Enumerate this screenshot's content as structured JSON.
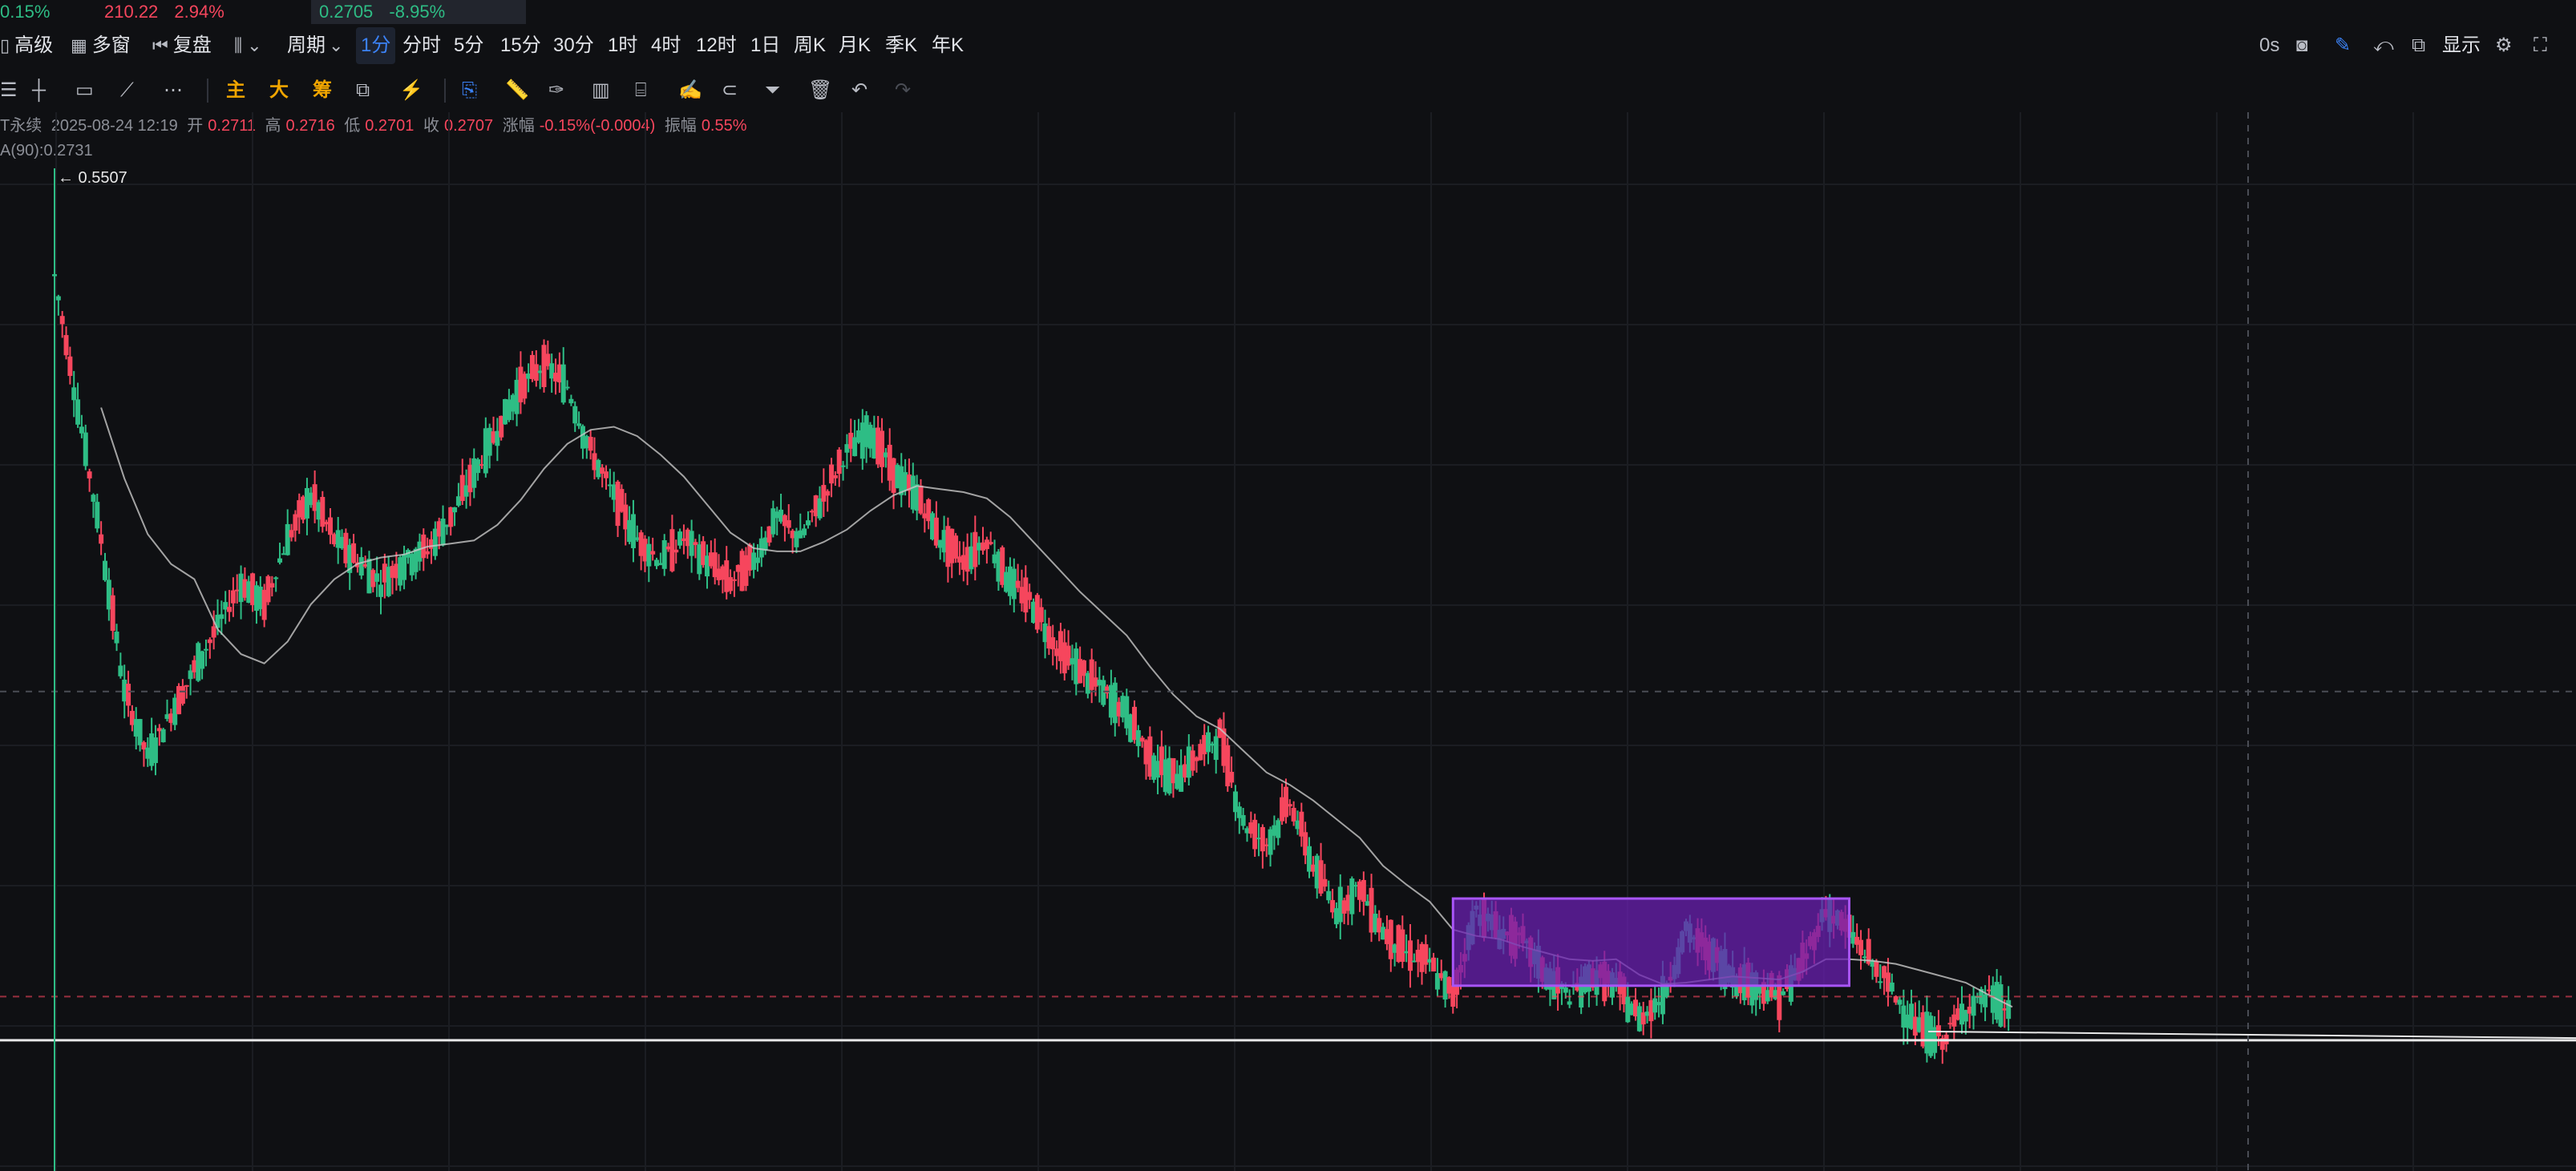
{
  "ticker": [
    {
      "change": "0.15%"
    },
    {
      "price": "210.22",
      "change": "2.94%"
    },
    {
      "price": "0.2705",
      "change": "-8.95%"
    }
  ],
  "toolbar": {
    "advanced": "高级",
    "multi_window": "多窗",
    "replay": "复盘",
    "period": "周期",
    "intervals": [
      "1分",
      "分时",
      "5分",
      "15分",
      "30分",
      "1时",
      "4时",
      "12时",
      "1日",
      "周K",
      "月K",
      "季K",
      "年K"
    ],
    "selected_interval": "1分",
    "right_timer": "0s",
    "display": "显示"
  },
  "tools2": {
    "main": "主",
    "big": "大",
    "chip": "筹"
  },
  "info": {
    "symbol_suffix": "T永续",
    "datetime": "2025-08-24 12:19",
    "open_label": "开",
    "open": "0.2711",
    "high_label": "高",
    "high": "0.2716",
    "low_label": "低",
    "low": "0.2701",
    "close_label": "收",
    "close": "0.2707",
    "change_label": "涨幅",
    "change": "-0.15%(-0.0004)",
    "amp_label": "振幅",
    "amp": "0.55%",
    "ma": "A(90):0.2731"
  },
  "colors": {
    "bg": "#0f1013",
    "up": "#2ebd85",
    "down": "#f6465d",
    "accent": "#3b82f6",
    "box_fill": "#6a1fb0",
    "box_stroke": "#a855f7",
    "ma_line": "#c8c8c8"
  },
  "chart_data": {
    "type": "line",
    "series": [
      {
        "values": [
          0.5507,
          0.49,
          0.43,
          0.36,
          0.33,
          0.35,
          0.37,
          0.39,
          0.41,
          0.4,
          0.43,
          0.45,
          0.43,
          0.42,
          0.41,
          0.42,
          0.425,
          0.44,
          0.46,
          0.48,
          0.5,
          0.51,
          0.5,
          0.47,
          0.45,
          0.43,
          0.42,
          0.43,
          0.42,
          0.41,
          0.42,
          0.44,
          0.43,
          0.45,
          0.47,
          0.48,
          0.46,
          0.45,
          0.43,
          0.42,
          0.43,
          0.41,
          0.4,
          0.38,
          0.37,
          0.36,
          0.35,
          0.33,
          0.32,
          0.33,
          0.34,
          0.3,
          0.29,
          0.31,
          0.28,
          0.26,
          0.27,
          0.25,
          0.24,
          0.235,
          0.22,
          0.26,
          0.25,
          0.245,
          0.23,
          0.22,
          0.23,
          0.225,
          0.21,
          0.22,
          0.25,
          0.24,
          0.23,
          0.225,
          0.22,
          0.235,
          0.26,
          0.25,
          0.235,
          0.22,
          0.205,
          0.2,
          0.215,
          0.22,
          0.212
        ]
      }
    ],
    "ma_label": "A(90):0.2731",
    "annotations": [
      {
        "text": "0.5507"
      }
    ],
    "ylim": [
      0.14,
      0.6
    ],
    "grid": true
  }
}
